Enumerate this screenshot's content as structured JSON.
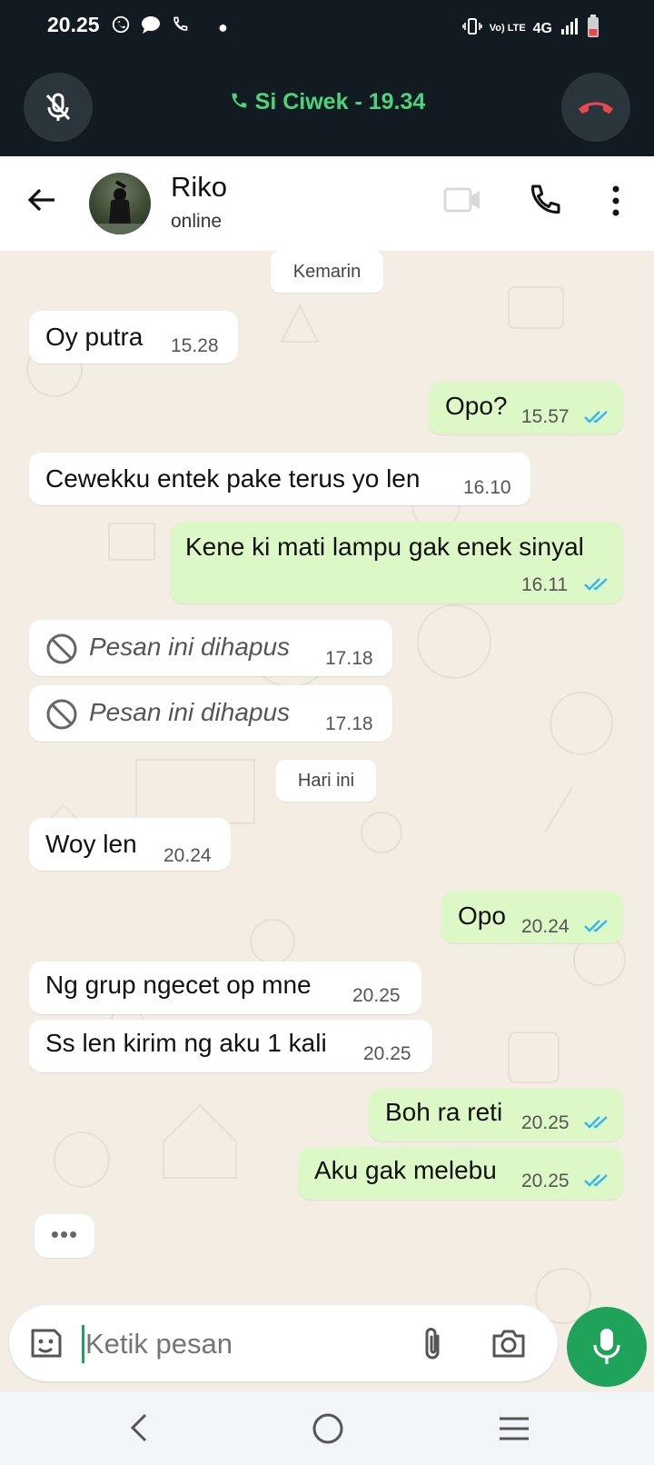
{
  "status_bar": {
    "time": "20.25",
    "network": "4G",
    "volte": "Vo) LTE"
  },
  "call_banner": {
    "label": "Si Ciwek - 19.34"
  },
  "header": {
    "name": "Riko",
    "status": "online"
  },
  "messages": [
    {
      "type": "day",
      "text": "Kemarin"
    },
    {
      "type": "in",
      "text": "Oy putra",
      "time": "15.28"
    },
    {
      "type": "out",
      "text": "Opo?",
      "time": "15.57"
    },
    {
      "type": "in",
      "text": "Cewekku entek pake terus yo len",
      "time": "16.10"
    },
    {
      "type": "out",
      "text": "Kene ki mati lampu gak enek sinyal",
      "time": "16.11"
    },
    {
      "type": "deleted",
      "text": "Pesan ini dihapus",
      "time": "17.18"
    },
    {
      "type": "deleted",
      "text": "Pesan ini dihapus",
      "time": "17.18"
    },
    {
      "type": "day",
      "text": "Hari ini"
    },
    {
      "type": "in",
      "text": "Woy len",
      "time": "20.24"
    },
    {
      "type": "out",
      "text": "Opo",
      "time": "20.24"
    },
    {
      "type": "in",
      "text": "Ng grup ngecet op mne",
      "time": "20.25"
    },
    {
      "type": "in",
      "text": "Ss len kirim ng aku 1 kali",
      "time": "20.25"
    },
    {
      "type": "out",
      "text": "Boh ra reti",
      "time": "20.25"
    },
    {
      "type": "out",
      "text": "Aku gak melebu",
      "time": "20.25"
    }
  ],
  "typing_indicator": "•••",
  "composer": {
    "placeholder": "Ketik pesan"
  },
  "colors": {
    "call_bar": "#121b22",
    "call_green": "#4cd47c",
    "end_red": "#e5484d",
    "outgoing": "#dcf8c6",
    "incoming": "#ffffff",
    "tick_blue": "#34b7f1",
    "accent": "#1fa35a"
  }
}
